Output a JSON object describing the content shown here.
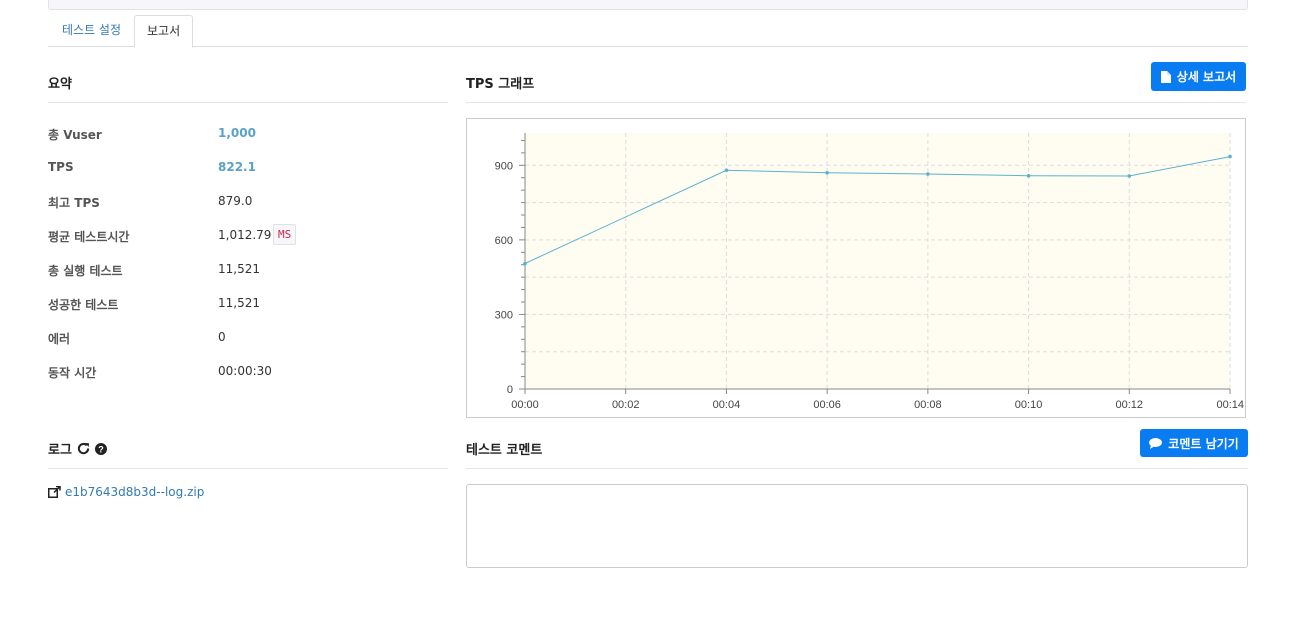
{
  "tabs": [
    {
      "label": "테스트 설정",
      "active": false
    },
    {
      "label": "보고서",
      "active": true
    }
  ],
  "summary": {
    "title": "요약",
    "rows": [
      {
        "label": "총 Vuser",
        "value": "1,000"
      },
      {
        "label": "TPS",
        "value": "822.1"
      },
      {
        "label": "최고 TPS",
        "value": "879.0"
      },
      {
        "label": "평균 테스트시간",
        "value": "1,012.79",
        "unit": "MS"
      },
      {
        "label": "총 실행 테스트",
        "value": "11,521"
      },
      {
        "label": "성공한 테스트",
        "value": "11,521"
      },
      {
        "label": "에러",
        "value": "0"
      },
      {
        "label": "동작 시간",
        "value": "00:00:30"
      }
    ]
  },
  "tps_graph": {
    "title": "TPS 그래프",
    "detail_button": "상세 보고서"
  },
  "chart_data": {
    "type": "line",
    "x": [
      "00:00",
      "00:04",
      "00:06",
      "00:08",
      "00:10",
      "00:12",
      "00:14"
    ],
    "x_seconds": [
      0,
      4,
      6,
      8,
      10,
      12,
      14
    ],
    "values": [
      505,
      880,
      870,
      865,
      858,
      857,
      935
    ],
    "xticks": [
      "00:00",
      "00:02",
      "00:04",
      "00:06",
      "00:08",
      "00:10",
      "00:12",
      "00:14"
    ],
    "yticks": [
      0,
      300,
      600,
      900
    ],
    "xlim": [
      0,
      14
    ],
    "ylim": [
      0,
      1030
    ],
    "grid": true,
    "colors": {
      "line": "#5ab3cc",
      "plot_bg": "#fffcf2",
      "grid": "#dddddd"
    }
  },
  "log": {
    "title": "로그",
    "file": "e1b7643d8b3d--log.zip"
  },
  "comment": {
    "title": "테스트 코멘트",
    "button": "코멘트 남기기"
  }
}
